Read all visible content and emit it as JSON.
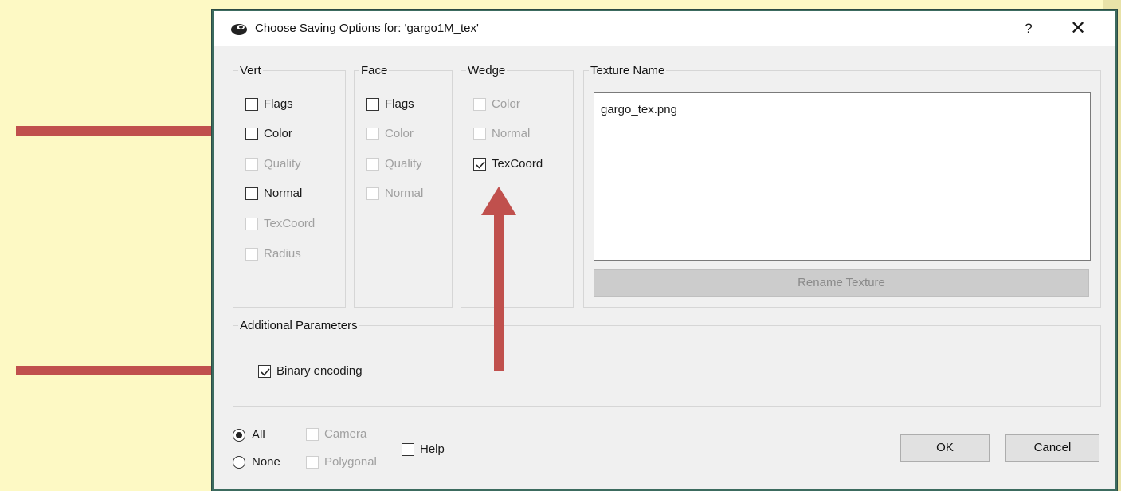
{
  "window": {
    "title": "Choose Saving Options for: 'gargo1M_tex'",
    "help_label": "?",
    "close_label": "✕"
  },
  "vert": {
    "legend": "Vert",
    "items": [
      {
        "label": "Flags",
        "checked": false,
        "enabled": true
      },
      {
        "label": "Color",
        "checked": false,
        "enabled": true
      },
      {
        "label": "Quality",
        "checked": false,
        "enabled": false
      },
      {
        "label": "Normal",
        "checked": false,
        "enabled": true
      },
      {
        "label": "TexCoord",
        "checked": false,
        "enabled": false
      },
      {
        "label": "Radius",
        "checked": false,
        "enabled": false
      }
    ]
  },
  "face": {
    "legend": "Face",
    "items": [
      {
        "label": "Flags",
        "checked": false,
        "enabled": true
      },
      {
        "label": "Color",
        "checked": false,
        "enabled": false
      },
      {
        "label": "Quality",
        "checked": false,
        "enabled": false
      },
      {
        "label": "Normal",
        "checked": false,
        "enabled": false
      }
    ]
  },
  "wedge": {
    "legend": "Wedge",
    "items": [
      {
        "label": "Color",
        "checked": false,
        "enabled": false
      },
      {
        "label": "Normal",
        "checked": false,
        "enabled": false
      },
      {
        "label": "TexCoord",
        "checked": true,
        "enabled": true
      }
    ]
  },
  "texture": {
    "legend": "Texture Name",
    "value": "gargo_tex.png",
    "rename_label": "Rename Texture"
  },
  "additional": {
    "legend": "Additional Parameters",
    "binary_label": "Binary encoding",
    "binary_checked": true
  },
  "footer": {
    "all_label": "All",
    "none_label": "None",
    "selected": "All",
    "camera_label": "Camera",
    "polygonal_label": "Polygonal",
    "help_label": "Help",
    "ok_label": "OK",
    "cancel_label": "Cancel"
  },
  "colors": {
    "annotation_arrow": "#c0504d",
    "background": "#fdf9c4",
    "window_border": "#3c6b5f"
  }
}
